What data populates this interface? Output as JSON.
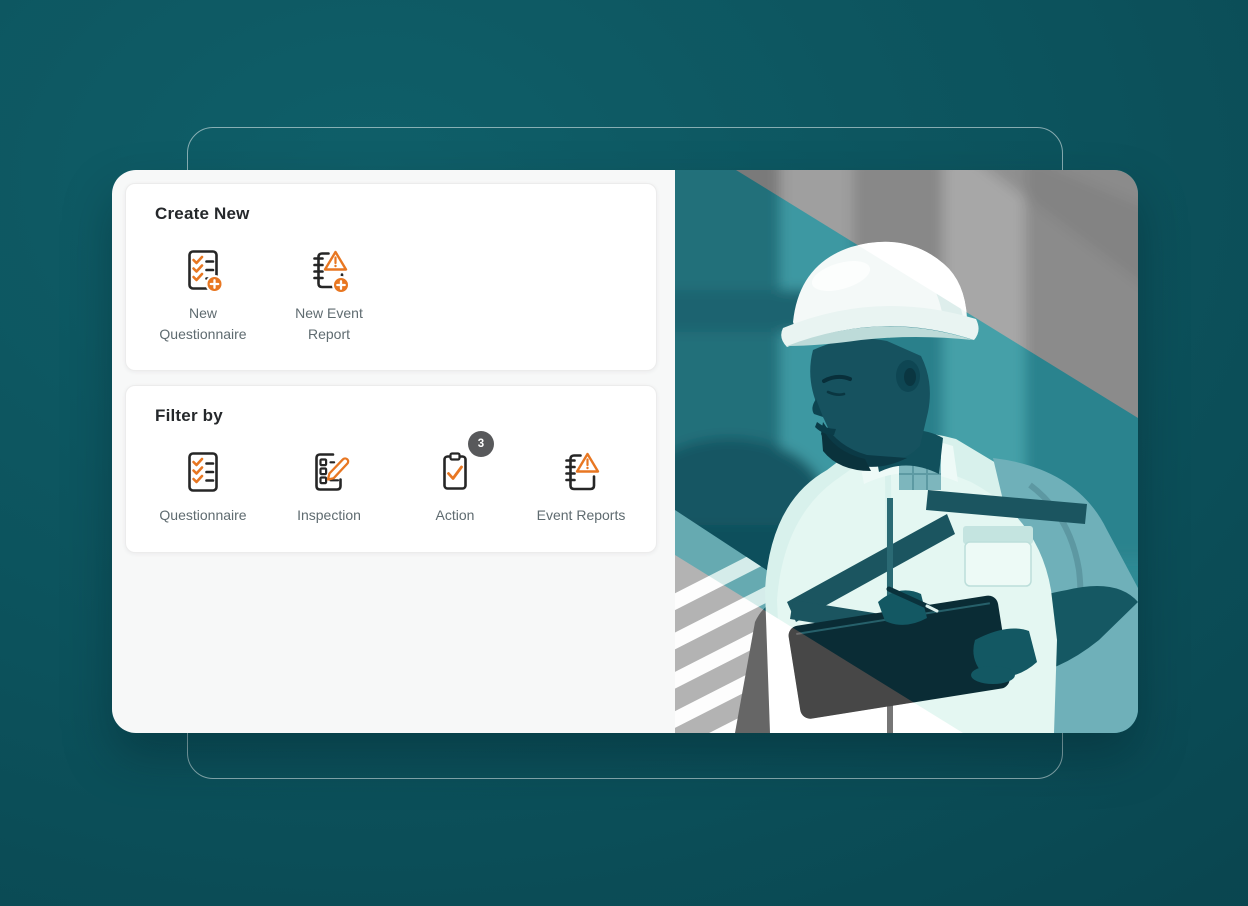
{
  "create_new_card": {
    "title": "Create New",
    "items": [
      {
        "label": "New Questionnaire",
        "icon": "new-questionnaire-icon"
      },
      {
        "label": "New Event Report",
        "icon": "new-event-report-icon"
      }
    ]
  },
  "filter_card": {
    "title": "Filter by",
    "items": [
      {
        "label": "Questionnaire",
        "icon": "questionnaire-icon"
      },
      {
        "label": "Inspection",
        "icon": "inspection-icon"
      },
      {
        "label": "Action",
        "icon": "action-icon",
        "badge": "3"
      },
      {
        "label": "Event Reports",
        "icon": "event-reports-icon"
      }
    ]
  },
  "colors": {
    "accent_orange": "#e87722",
    "icon_dark": "#262626",
    "badge_bg": "#58595b",
    "label_gray": "#5f6b70",
    "title_dark": "#25282b",
    "panel_bg": "#f7f8f8",
    "page_teal": "#0c525c",
    "photo_teal_overlay": "#2e8a94"
  },
  "hero": {
    "description": "Industrial worker in a white hard hat and safety vest writing on a tablet; teal duotone photo with grayscale diagonal corners"
  }
}
